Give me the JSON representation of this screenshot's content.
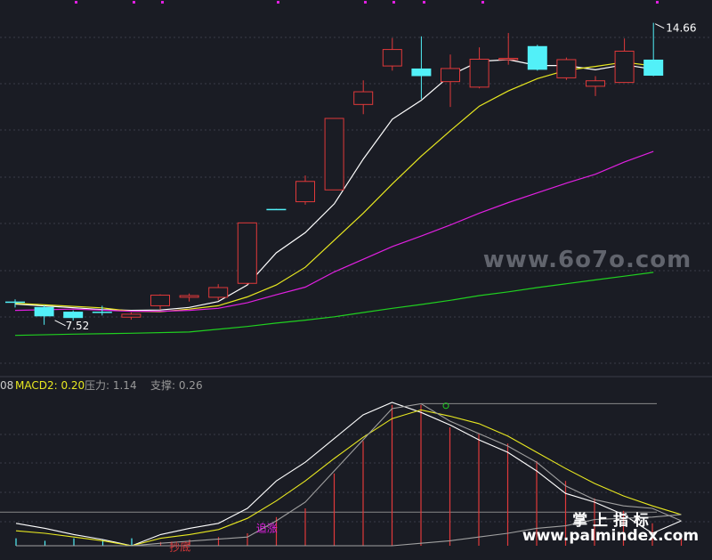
{
  "chart_data": [
    {
      "type": "candlestick",
      "title": "",
      "ylim": [
        6.4,
        15.2
      ],
      "colors": {
        "up": "#e0393a",
        "down": "#52f0f8",
        "background": "#1a1c24",
        "grid": "#3a3d48"
      },
      "candles": [
        {
          "x": 1,
          "open": 8.07,
          "high": 8.12,
          "low": 7.93,
          "close": 8.05
        },
        {
          "x": 2,
          "open": 7.94,
          "high": 7.98,
          "low": 7.52,
          "close": 7.72
        },
        {
          "x": 3,
          "open": 7.83,
          "high": 7.86,
          "low": 7.62,
          "close": 7.68
        },
        {
          "x": 4,
          "open": 7.83,
          "high": 7.97,
          "low": 7.74,
          "close": 7.8
        },
        {
          "x": 5,
          "open": 7.7,
          "high": 7.81,
          "low": 7.64,
          "close": 7.77
        },
        {
          "x": 6,
          "open": 7.97,
          "high": 8.24,
          "low": 7.88,
          "close": 8.22
        },
        {
          "x": 7,
          "open": 8.17,
          "high": 8.26,
          "low": 8.07,
          "close": 8.21
        },
        {
          "x": 8,
          "open": 8.17,
          "high": 8.48,
          "low": 8.1,
          "close": 8.4
        },
        {
          "x": 9,
          "open": 8.5,
          "high": 9.93,
          "low": 8.47,
          "close": 9.93
        },
        {
          "x": 10,
          "open": 10.26,
          "high": 10.26,
          "low": 10.24,
          "close": 10.25
        },
        {
          "x": 11,
          "open": 10.43,
          "high": 11.05,
          "low": 10.36,
          "close": 10.91
        },
        {
          "x": 12,
          "open": 10.71,
          "high": 12.4,
          "low": 10.71,
          "close": 12.4
        },
        {
          "x": 13,
          "open": 12.73,
          "high": 13.3,
          "low": 12.5,
          "close": 13.03
        },
        {
          "x": 14,
          "open": 13.64,
          "high": 14.3,
          "low": 13.53,
          "close": 14.03
        },
        {
          "x": 15,
          "open": 13.58,
          "high": 14.34,
          "low": 12.86,
          "close": 13.4
        },
        {
          "x": 16,
          "open": 13.27,
          "high": 13.91,
          "low": 12.67,
          "close": 13.58
        },
        {
          "x": 17,
          "open": 13.14,
          "high": 14.08,
          "low": 13.11,
          "close": 13.8
        },
        {
          "x": 18,
          "open": 13.8,
          "high": 14.42,
          "low": 13.67,
          "close": 13.82
        },
        {
          "x": 19,
          "open": 14.11,
          "high": 14.14,
          "low": 13.53,
          "close": 13.55
        },
        {
          "x": 20,
          "open": 13.36,
          "high": 13.84,
          "low": 13.31,
          "close": 13.79
        },
        {
          "x": 21,
          "open": 13.16,
          "high": 13.4,
          "low": 12.93,
          "close": 13.29
        },
        {
          "x": 22,
          "open": 13.25,
          "high": 14.29,
          "low": 13.25,
          "close": 13.99
        },
        {
          "x": 23,
          "open": 13.79,
          "high": 14.66,
          "low": 13.4,
          "close": 13.41
        }
      ],
      "moving_averages": [
        {
          "color": "#ffffff",
          "points": [
            [
              1,
              8.01
            ],
            [
              4,
              7.88
            ],
            [
              5,
              7.86
            ],
            [
              6,
              7.87
            ],
            [
              7,
              7.93
            ],
            [
              8,
              8.07
            ],
            [
              9,
              8.46
            ],
            [
              10,
              9.22
            ],
            [
              11,
              9.7
            ],
            [
              12,
              10.38
            ],
            [
              13,
              11.44
            ],
            [
              14,
              12.38
            ],
            [
              15,
              12.83
            ],
            [
              16,
              13.42
            ],
            [
              17,
              13.75
            ],
            [
              18,
              13.79
            ],
            [
              19,
              13.65
            ],
            [
              20,
              13.65
            ],
            [
              21,
              13.55
            ],
            [
              22,
              13.67
            ],
            [
              23,
              13.56
            ]
          ]
        },
        {
          "color": "#e8e820",
          "points": [
            [
              1,
              8.03
            ],
            [
              4,
              7.92
            ],
            [
              5,
              7.84
            ],
            [
              6,
              7.83
            ],
            [
              7,
              7.89
            ],
            [
              8,
              7.97
            ],
            [
              9,
              8.18
            ],
            [
              10,
              8.46
            ],
            [
              11,
              8.88
            ],
            [
              12,
              9.52
            ],
            [
              13,
              10.16
            ],
            [
              14,
              10.85
            ],
            [
              15,
              11.51
            ],
            [
              16,
              12.11
            ],
            [
              17,
              12.69
            ],
            [
              18,
              13.05
            ],
            [
              19,
              13.34
            ],
            [
              20,
              13.54
            ],
            [
              21,
              13.63
            ],
            [
              22,
              13.73
            ],
            [
              23,
              13.64
            ]
          ]
        },
        {
          "color": "#e020e0",
          "points": [
            [
              1,
              7.86
            ],
            [
              3,
              7.89
            ],
            [
              5,
              7.84
            ],
            [
              6,
              7.84
            ],
            [
              7,
              7.86
            ],
            [
              8,
              7.91
            ],
            [
              9,
              8.04
            ],
            [
              10,
              8.23
            ],
            [
              11,
              8.41
            ],
            [
              12,
              8.77
            ],
            [
              13,
              9.07
            ],
            [
              14,
              9.37
            ],
            [
              15,
              9.62
            ],
            [
              16,
              9.88
            ],
            [
              17,
              10.16
            ],
            [
              18,
              10.41
            ],
            [
              19,
              10.64
            ],
            [
              20,
              10.87
            ],
            [
              21,
              11.08
            ],
            [
              22,
              11.37
            ],
            [
              23,
              11.62
            ]
          ]
        },
        {
          "color": "#20d020",
          "points": [
            [
              1,
              7.27
            ],
            [
              3,
              7.3
            ],
            [
              5,
              7.32
            ],
            [
              7,
              7.35
            ],
            [
              9,
              7.48
            ],
            [
              10,
              7.56
            ],
            [
              11,
              7.63
            ],
            [
              12,
              7.71
            ],
            [
              13,
              7.81
            ],
            [
              14,
              7.91
            ],
            [
              15,
              8.0
            ],
            [
              16,
              8.1
            ],
            [
              17,
              8.21
            ],
            [
              18,
              8.3
            ],
            [
              19,
              8.4
            ],
            [
              20,
              8.49
            ],
            [
              21,
              8.58
            ],
            [
              22,
              8.67
            ],
            [
              23,
              8.76
            ]
          ]
        }
      ],
      "annotations": [
        {
          "label": "14.66",
          "x": 23,
          "y": 14.66,
          "kind": "high"
        },
        {
          "label": "7.52",
          "x": 2,
          "y": 7.52,
          "kind": "low"
        }
      ]
    },
    {
      "type": "line",
      "legend_text": {
        "prefix": "08",
        "macd2_label": "MACD2: 0.20",
        "pressure_label": "压力: 1.14",
        "support_label": "支撑: 0.26"
      },
      "ylim": [
        -0.05,
        1.2
      ],
      "reference_lines": [
        {
          "y": 0.27,
          "color": "#888888"
        },
        {
          "y": 1.14,
          "from_x": 14,
          "color": "#888888"
        }
      ],
      "series": [
        {
          "color": "#ffffff",
          "points": [
            [
              0,
              0.18
            ],
            [
              1,
              0.14
            ],
            [
              2,
              0.09
            ],
            [
              3,
              0.05
            ],
            [
              4,
              0.0
            ],
            [
              5,
              0.09
            ],
            [
              6,
              0.14
            ],
            [
              7,
              0.18
            ],
            [
              8,
              0.3
            ],
            [
              9,
              0.52
            ],
            [
              10,
              0.67
            ],
            [
              11,
              0.86
            ],
            [
              12,
              1.05
            ],
            [
              13,
              1.15
            ],
            [
              14,
              1.07
            ],
            [
              15,
              0.97
            ],
            [
              16,
              0.85
            ],
            [
              17,
              0.75
            ],
            [
              18,
              0.6
            ],
            [
              19,
              0.42
            ],
            [
              20,
              0.35
            ],
            [
              21,
              0.25
            ],
            [
              22,
              0.1
            ],
            [
              23,
              0.2
            ]
          ]
        },
        {
          "color": "#e8e820",
          "points": [
            [
              0,
              0.12
            ],
            [
              1,
              0.1
            ],
            [
              2,
              0.07
            ],
            [
              3,
              0.04
            ],
            [
              4,
              0.0
            ],
            [
              5,
              0.06
            ],
            [
              6,
              0.09
            ],
            [
              7,
              0.13
            ],
            [
              8,
              0.22
            ],
            [
              9,
              0.36
            ],
            [
              10,
              0.52
            ],
            [
              11,
              0.7
            ],
            [
              12,
              0.87
            ],
            [
              13,
              1.02
            ],
            [
              14,
              1.09
            ],
            [
              15,
              1.04
            ],
            [
              16,
              0.98
            ],
            [
              17,
              0.88
            ],
            [
              18,
              0.75
            ],
            [
              19,
              0.62
            ],
            [
              20,
              0.5
            ],
            [
              21,
              0.4
            ],
            [
              22,
              0.32
            ],
            [
              23,
              0.25
            ]
          ]
        },
        {
          "color": "#a0a0a0",
          "points": [
            [
              0,
              0.0
            ],
            [
              4,
              0.0
            ],
            [
              5,
              0.02
            ],
            [
              8,
              0.07
            ],
            [
              9,
              0.2
            ],
            [
              10,
              0.35
            ],
            [
              11,
              0.6
            ],
            [
              12,
              0.85
            ],
            [
              13,
              1.1
            ],
            [
              14,
              1.14
            ],
            [
              15,
              1.0
            ],
            [
              16,
              0.9
            ],
            [
              17,
              0.8
            ],
            [
              18,
              0.67
            ],
            [
              19,
              0.48
            ],
            [
              20,
              0.37
            ],
            [
              21,
              0.32
            ],
            [
              22,
              0.3
            ],
            [
              23,
              0.2
            ]
          ]
        },
        {
          "color": "#a0a0a0",
          "points": [
            [
              0,
              0.0
            ],
            [
              4,
              0.0
            ],
            [
              9,
              0.0
            ],
            [
              13,
              0.0
            ],
            [
              14,
              0.02
            ],
            [
              15,
              0.04
            ],
            [
              16,
              0.07
            ],
            [
              17,
              0.1
            ],
            [
              18,
              0.14
            ],
            [
              19,
              0.16
            ],
            [
              20,
              0.21
            ],
            [
              21,
              0.22
            ],
            [
              22,
              0.23
            ],
            [
              23,
              0.25
            ]
          ]
        }
      ],
      "bars": [
        {
          "x": 0,
          "value": 0.06,
          "color": "#52f0f8"
        },
        {
          "x": 1,
          "value": 0.04,
          "color": "#52f0f8"
        },
        {
          "x": 2,
          "value": 0.06,
          "color": "#52f0f8"
        },
        {
          "x": 3,
          "value": 0.05,
          "color": "#52f0f8"
        },
        {
          "x": 4,
          "value": 0.06,
          "color": "#52f0f8"
        },
        {
          "x": 5,
          "value": 0.03,
          "color": "#e0393a"
        },
        {
          "x": 6,
          "value": 0.05,
          "color": "#e0393a"
        },
        {
          "x": 7,
          "value": 0.07,
          "color": "#e0393a"
        },
        {
          "x": 8,
          "value": 0.1,
          "color": "#e0393a"
        },
        {
          "x": 9,
          "value": 0.23,
          "color": "#e0393a"
        },
        {
          "x": 10,
          "value": 0.3,
          "color": "#e0393a"
        },
        {
          "x": 11,
          "value": 0.58,
          "color": "#e0393a"
        },
        {
          "x": 12,
          "value": 0.84,
          "color": "#e0393a"
        },
        {
          "x": 13,
          "value": 1.13,
          "color": "#e0393a"
        },
        {
          "x": 14,
          "value": 1.13,
          "color": "#e0393a"
        },
        {
          "x": 15,
          "value": 0.95,
          "color": "#e0393a"
        },
        {
          "x": 16,
          "value": 0.9,
          "color": "#e0393a"
        },
        {
          "x": 17,
          "value": 0.82,
          "color": "#e0393a"
        },
        {
          "x": 18,
          "value": 0.68,
          "color": "#e0393a"
        },
        {
          "x": 19,
          "value": 0.52,
          "color": "#e0393a"
        },
        {
          "x": 20,
          "value": 0.38,
          "color": "#e0393a"
        },
        {
          "x": 21,
          "value": 0.28,
          "color": "#e0393a"
        },
        {
          "x": 22,
          "value": 0.18,
          "color": "#e0393a"
        },
        {
          "x": 23,
          "value": 0.07,
          "color": "#e0393a"
        }
      ],
      "annotations": [
        {
          "label": "追涨",
          "x": 8.3,
          "y": 0.11,
          "color": "#e020e0"
        },
        {
          "label": "抄底",
          "x": 5.3,
          "y": -0.04,
          "color": "#e0393a"
        }
      ],
      "markers": [
        {
          "x": 14,
          "y": 1.13,
          "shape": "circle",
          "color": "#20d020"
        }
      ]
    }
  ],
  "watermarks": {
    "middle": "www.6o7o.com",
    "bottom_chinese": "掌 上 指 标",
    "bottom_url": "www.palmindex.com"
  }
}
